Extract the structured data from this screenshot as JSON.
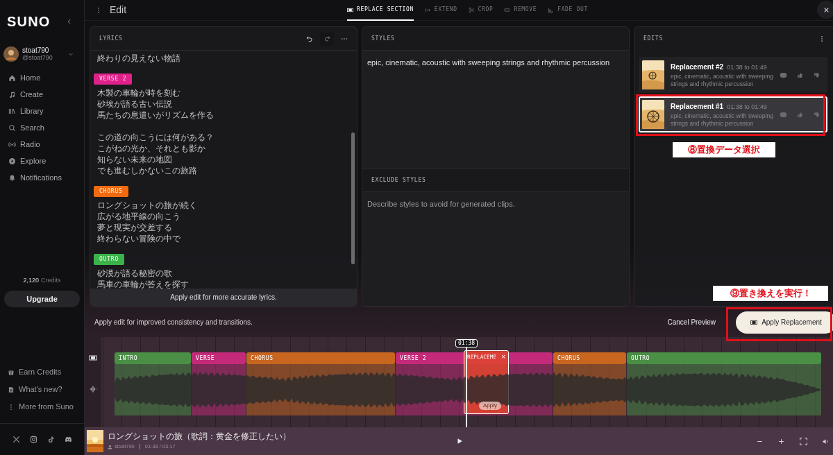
{
  "sidebar": {
    "logo": "SUNO",
    "user": {
      "name": "stoat790",
      "handle": "@stoat790"
    },
    "nav": [
      {
        "label": "Home"
      },
      {
        "label": "Create"
      },
      {
        "label": "Library"
      },
      {
        "label": "Search"
      },
      {
        "label": "Radio"
      },
      {
        "label": "Explore"
      },
      {
        "label": "Notifications"
      }
    ],
    "credits_amount": "2,120",
    "credits_label": "Credits",
    "upgrade": "Upgrade",
    "footer_links": [
      {
        "label": "Earn Credits"
      },
      {
        "label": "What's new?"
      },
      {
        "label": "More from Suno"
      }
    ]
  },
  "header": {
    "title": "Edit",
    "tabs": [
      {
        "label": "REPLACE SECTION",
        "selected": true
      },
      {
        "label": "EXTEND",
        "selected": false
      },
      {
        "label": "CROP",
        "selected": false
      },
      {
        "label": "REMOVE",
        "selected": false
      },
      {
        "label": "FADE OUT",
        "selected": false
      }
    ]
  },
  "lyrics": {
    "title": "LYRICS",
    "blocks": [
      {
        "kind": "line",
        "text": "終わりの見えない物語"
      },
      {
        "kind": "tag",
        "text": "VERSE 2",
        "color": "#e0218a"
      },
      {
        "kind": "line",
        "text": "木製の車輪が時を刻む"
      },
      {
        "kind": "line",
        "text": "砂埃が語る古い伝説"
      },
      {
        "kind": "line",
        "text": "馬たちの息遣いがリズムを作る"
      },
      {
        "kind": "gap"
      },
      {
        "kind": "line",
        "text": "この道の向こうには何がある？"
      },
      {
        "kind": "line",
        "text": "こがねの光か、それとも影か"
      },
      {
        "kind": "line",
        "text": "知らない未来の地図"
      },
      {
        "kind": "line",
        "text": "でも進むしかないこの旅路"
      },
      {
        "kind": "tag",
        "text": "CHORUS",
        "color": "#f26a0f"
      },
      {
        "kind": "line",
        "text": "ロングショットの旅が続く"
      },
      {
        "kind": "line",
        "text": "広がる地平線の向こう"
      },
      {
        "kind": "line",
        "text": "夢と現実が交差する"
      },
      {
        "kind": "line",
        "text": "終わらない冒険の中で"
      },
      {
        "kind": "tag",
        "text": "OUTRO",
        "color": "#3bb34a"
      },
      {
        "kind": "line",
        "text": "砂漠が語る秘密の歌"
      },
      {
        "kind": "line",
        "text": "馬車の車輪が答えを探す"
      }
    ],
    "note": "Apply edit for more accurate lyrics."
  },
  "styles": {
    "title": "STYLES",
    "value": "epic, cinematic, acoustic with sweeping strings and rhythmic percussion"
  },
  "exclude_styles": {
    "title": "EXCLUDE STYLES",
    "placeholder": "Describe styles to avoid for generated clips."
  },
  "edits": {
    "title": "EDITS",
    "items": [
      {
        "title": "Replacement #2",
        "range": "01:38 to 01:49",
        "description": "epic, cinematic, acoustic with sweeping strings and rhythmic percussion",
        "selected": false
      },
      {
        "title": "Replacement #1",
        "range": "01:38 to 01:49",
        "description": "epic, cinematic, acoustic with sweeping strings and rhythmic percussion",
        "selected": true
      }
    ]
  },
  "actions": {
    "message": "Apply edit for improved consistency and transitions.",
    "cancel": "Cancel Preview",
    "apply": "Apply Replacement"
  },
  "timeline": {
    "sections": [
      {
        "label": "INTRO",
        "color": "#4a8f45"
      },
      {
        "label": "VERSE",
        "color": "#c42a7a"
      },
      {
        "label": "CHORUS",
        "color": "#c8651f"
      },
      {
        "label": "VERSE 2",
        "color": "#c42a7a"
      },
      {
        "label": "CHORUS",
        "color": "#c8651f"
      },
      {
        "label": "OUTRO",
        "color": "#4a8f45"
      }
    ],
    "replacement": {
      "label": "REPLACEME",
      "close": "×",
      "apply": "Apply"
    },
    "playhead": "01:38"
  },
  "player": {
    "title": "ロングショットの旅（歌詞：黄金を修正したい）",
    "artist": "stoat790",
    "time": "01:38 / 03:17"
  },
  "annotations": [
    {
      "text": "⑧置換データ選択"
    },
    {
      "text": "⑨置き換えを実行！"
    }
  ]
}
